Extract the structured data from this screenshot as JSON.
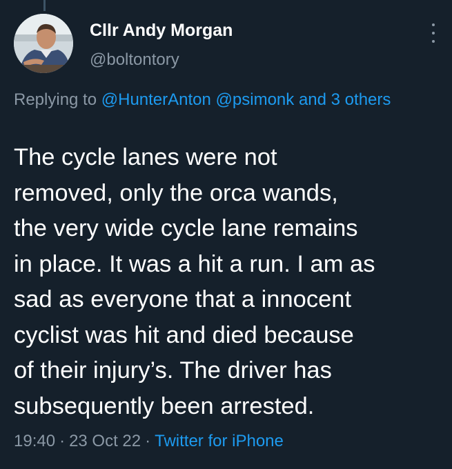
{
  "user": {
    "display_name": "Cllr Andy Morgan",
    "handle": "@boltontory",
    "avatar_icon": "profile-photo"
  },
  "menu": {
    "icon": "more-options-icon"
  },
  "reply": {
    "prefix": "Replying to ",
    "mention_1": "@HunterAnton",
    "mention_2": "@psimonk",
    "others": "and 3 others"
  },
  "tweet": {
    "lines": [
      "The cycle lanes were not",
      "removed, only the orca wands,",
      "the very wide cycle lane remains",
      "in place. It was a hit a run. I am as",
      "sad as everyone that a innocent",
      "cyclist was hit and died because",
      "of their injury’s. The driver has",
      "subsequently been arrested."
    ]
  },
  "meta": {
    "time": "19:40",
    "separator": "·",
    "date": "23 Oct 22",
    "source": "Twitter for iPhone"
  },
  "colors": {
    "background": "#15202b",
    "link": "#1d9bf0",
    "secondary_text": "#8b98a5",
    "primary_text": "#ffffff"
  }
}
